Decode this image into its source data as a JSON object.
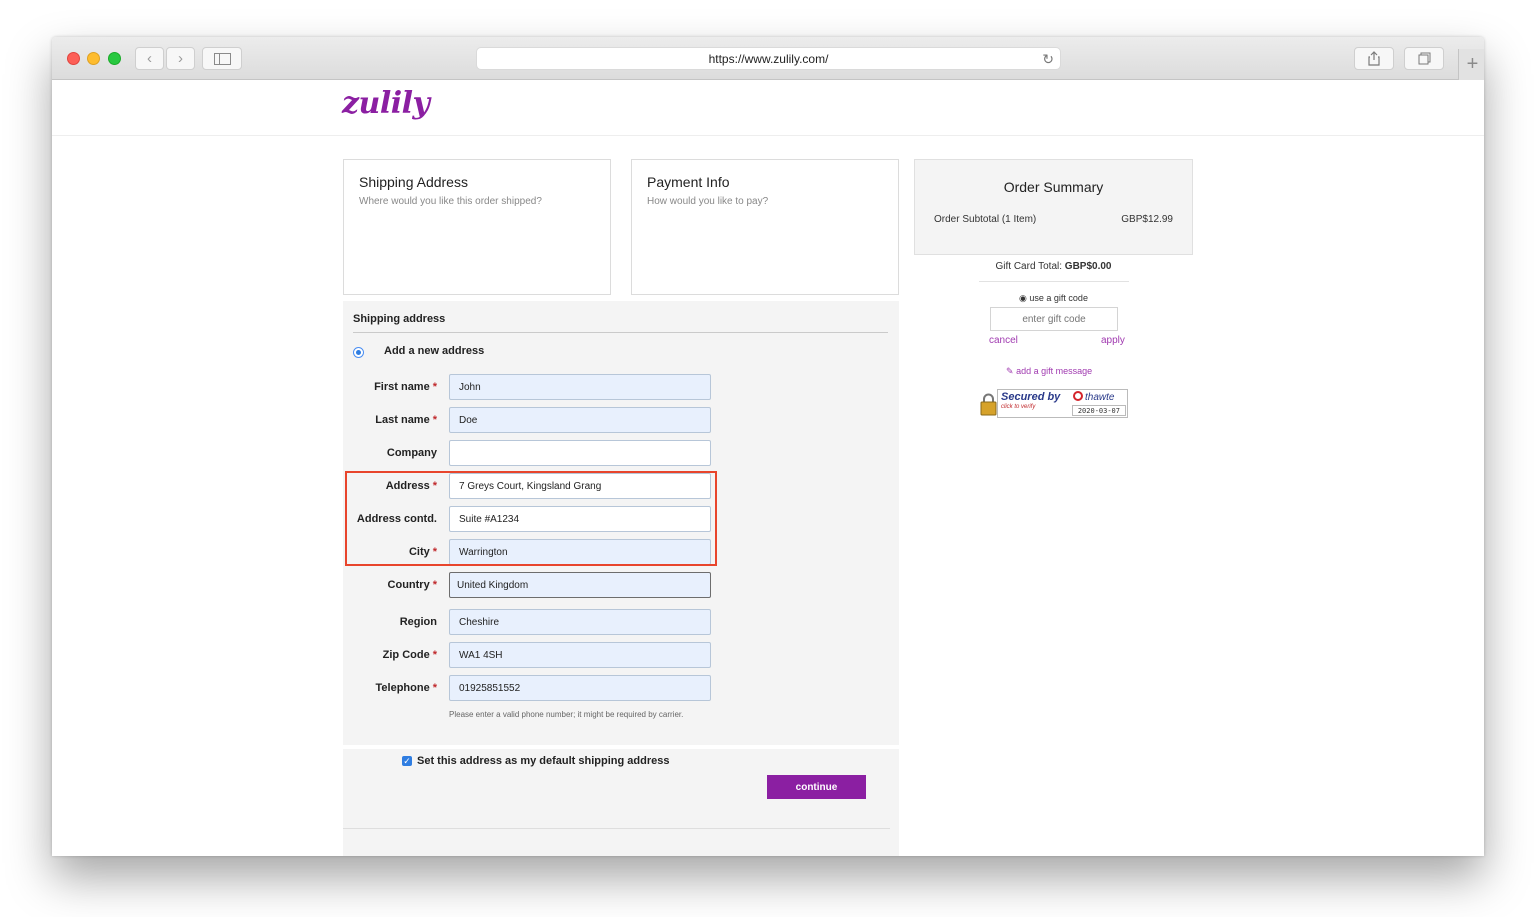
{
  "browser": {
    "url": "https://www.zulily.com/"
  },
  "site": {
    "logo": "zulily"
  },
  "cards": {
    "shipping": {
      "title": "Shipping Address",
      "subtitle": "Where would you like this order shipped?"
    },
    "payment": {
      "title": "Payment Info",
      "subtitle": "How would you like to pay?"
    }
  },
  "summary": {
    "title": "Order Summary",
    "subtotal_label": "Order Subtotal (1 Item)",
    "subtotal_value": "GBP$12.99",
    "gift_card_label": "Gift Card Total:",
    "gift_card_value": "GBP$0.00",
    "use_gift_code": "use a gift code",
    "gift_code_placeholder": "enter gift code",
    "cancel": "cancel",
    "apply": "apply",
    "gift_message": "add a gift message",
    "badge": {
      "secured_by": "Secured by",
      "click_to_verify": "click to verify",
      "brand": "thawte",
      "date": "2020-03-07"
    }
  },
  "form": {
    "section_title": "Shipping address",
    "new_address_label": "Add a new address",
    "required_marker": "*",
    "fields": {
      "first_name": {
        "label": "First name",
        "value": "John"
      },
      "last_name": {
        "label": "Last name",
        "value": "Doe"
      },
      "company": {
        "label": "Company",
        "value": ""
      },
      "address": {
        "label": "Address",
        "value": "7 Greys Court, Kingsland Grang"
      },
      "address2": {
        "label": "Address contd.",
        "value": "Suite #A1234"
      },
      "city": {
        "label": "City",
        "value": "Warrington"
      },
      "country": {
        "label": "Country",
        "value": "United Kingdom"
      },
      "region": {
        "label": "Region",
        "value": "Cheshire"
      },
      "zip": {
        "label": "Zip Code",
        "value": "WA1 4SH"
      },
      "telephone": {
        "label": "Telephone",
        "value": "01925851552"
      }
    },
    "phone_help": "Please enter a valid phone number; it might be required by carrier.",
    "default_checkbox_label": "Set this address as my default shipping address",
    "continue_label": "continue"
  },
  "colors": {
    "brand": "#8b1fa2",
    "highlight": "#e8452c",
    "input_fill": "#e8f0fd"
  }
}
